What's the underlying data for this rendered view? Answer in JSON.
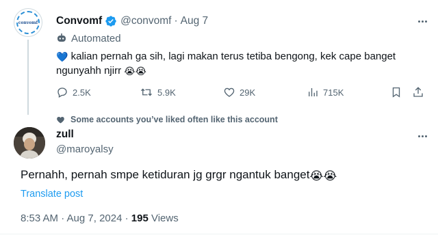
{
  "tweet": {
    "author_name": "Convomf",
    "author_handle": "@convomf",
    "separator": "·",
    "date": "Aug 7",
    "avatar_text": "convomf",
    "automated_label": "Automated",
    "text": "kalian pernah ga sih, lagi makan terus tetiba bengong, kek cape banget ngunyahh njirr",
    "leading_emoji": "💙",
    "trailing_emojis": "😭😭",
    "stats": {
      "replies": "2.5K",
      "reposts": "5.9K",
      "likes": "29K",
      "views": "715K"
    }
  },
  "social_context": "Some accounts you’ve liked often like this account",
  "reply": {
    "author_name": "zull",
    "author_handle": "@maroyalsy",
    "text": "Pernahh, pernah smpe ketiduran jg grgr ngantuk banget",
    "trailing_emojis": "😭😭",
    "translate_label": "Translate post",
    "time": "8:53 AM · Aug 7, 2024 · ",
    "views_count": "195",
    "views_label": " Views"
  },
  "colors": {
    "accent": "#1d9bf0",
    "text_primary": "#0f1419",
    "text_secondary": "#536471",
    "heart_emoji": "#5aa9e6"
  },
  "icons": [
    "verified-badge-icon",
    "bot-icon",
    "reply-icon",
    "repost-icon",
    "like-icon",
    "views-icon",
    "bookmark-icon",
    "share-icon",
    "more-icon",
    "heart-icon"
  ]
}
